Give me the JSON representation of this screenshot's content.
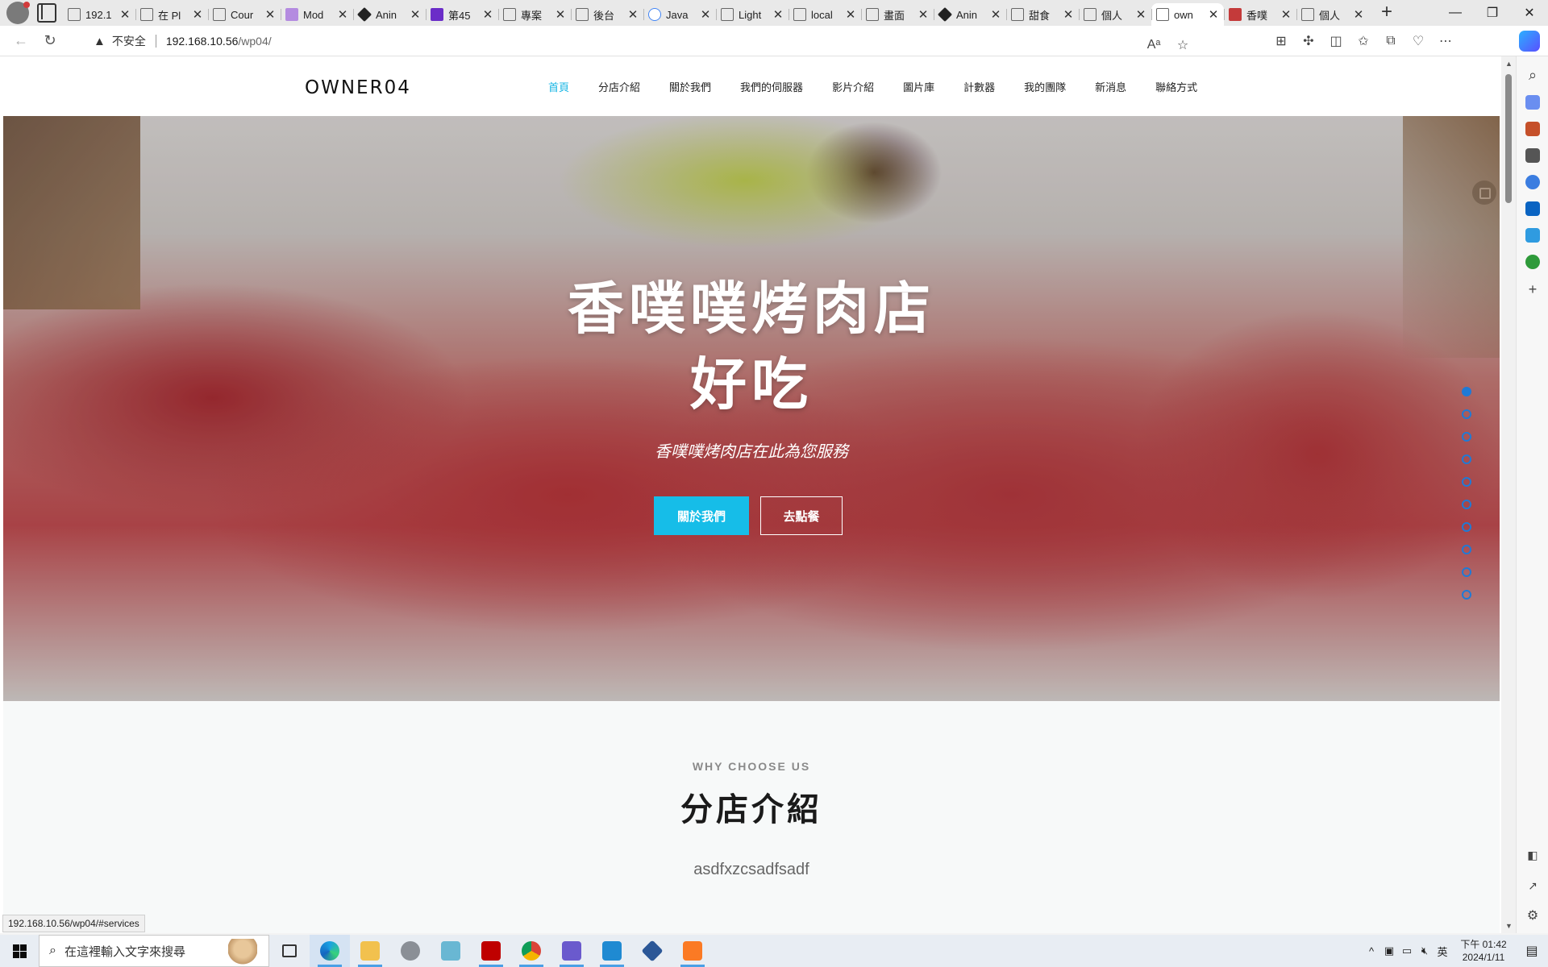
{
  "browser": {
    "tabs": [
      {
        "label": "192.1",
        "icon": "page-icon"
      },
      {
        "label": "在 Pl",
        "icon": "page-icon"
      },
      {
        "label": "Cour",
        "icon": "gear-icon"
      },
      {
        "label": "Mod",
        "icon": "bootstrap-icon"
      },
      {
        "label": "Anin",
        "icon": "diamond-icon"
      },
      {
        "label": "第45",
        "icon": "h-icon"
      },
      {
        "label": "專案",
        "icon": "page-icon"
      },
      {
        "label": "後台",
        "icon": "page-icon"
      },
      {
        "label": "Java",
        "icon": "google-icon"
      },
      {
        "label": "Light",
        "icon": "page-icon"
      },
      {
        "label": "local",
        "icon": "page-icon"
      },
      {
        "label": "畫面",
        "icon": "page-icon"
      },
      {
        "label": "Anin",
        "icon": "diamond-icon"
      },
      {
        "label": "甜食",
        "icon": "page-icon"
      },
      {
        "label": "個人",
        "icon": "page-icon"
      },
      {
        "label": "own",
        "icon": "page-icon",
        "active": true
      },
      {
        "label": "香噗",
        "icon": "image-icon"
      },
      {
        "label": "個人",
        "icon": "page-icon"
      }
    ],
    "address": {
      "security_label": "不安全",
      "host": "192.168.10.56",
      "path": "/wp04/"
    },
    "status_link": "192.168.10.56/wp04/#services"
  },
  "site": {
    "logo": "OWNER04",
    "nav": [
      "首頁",
      "分店介紹",
      "關於我們",
      "我們的伺服器",
      "影片介紹",
      "圖片庫",
      "計數器",
      "我的團隊",
      "新消息",
      "聯絡方式"
    ],
    "hero": {
      "title_line1": "香噗噗烤肉店",
      "title_line2": "好吃",
      "subtitle": "香噗噗烤肉店在此為您服務",
      "btn_primary": "關於我們",
      "btn_secondary": "去點餐"
    },
    "slide_count": 10,
    "services": {
      "eyebrow": "WHY CHOOSE US",
      "title": "分店介紹",
      "text": "asdfxzcsadfsadf"
    }
  },
  "taskbar": {
    "search_placeholder": "在這裡輸入文字來搜尋",
    "ime": "英",
    "time": "下午 01:42",
    "date": "2024/1/11"
  },
  "colors": {
    "accent": "#16bde8",
    "nav_active": "#18b6e4",
    "dot": "#1f7ad6"
  }
}
